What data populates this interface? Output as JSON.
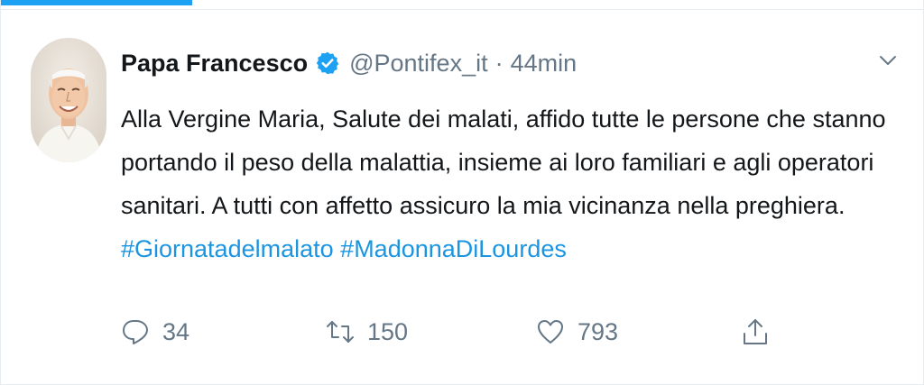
{
  "tweet": {
    "author_name": "Papa Francesco",
    "handle": "@Pontifex_it",
    "separator": "·",
    "time": "44min",
    "text_lines": [
      "Alla Vergine Maria, Salute dei malati, affido tutte le persone che stanno",
      "portando il peso della malattia, insieme ai loro familiari e agli operatori",
      "sanitari. A tutti con affetto assicuro la mia vicinanza nella preghiera."
    ],
    "hashtags": [
      "#Giornatadelmalato",
      "#MadonnaDiLourdes"
    ],
    "hashtag_separator": " "
  },
  "actions": {
    "reply_count": "34",
    "retweet_count": "150",
    "like_count": "793"
  },
  "icons": {
    "verified": "verified-badge-icon",
    "caret": "chevron-down-icon",
    "reply": "reply-icon",
    "retweet": "retweet-icon",
    "like": "heart-icon",
    "share": "share-icon"
  },
  "colors": {
    "accent": "#1da1f2",
    "hashtag": "#1b95e0",
    "text": "#14171a",
    "muted": "#657786"
  }
}
